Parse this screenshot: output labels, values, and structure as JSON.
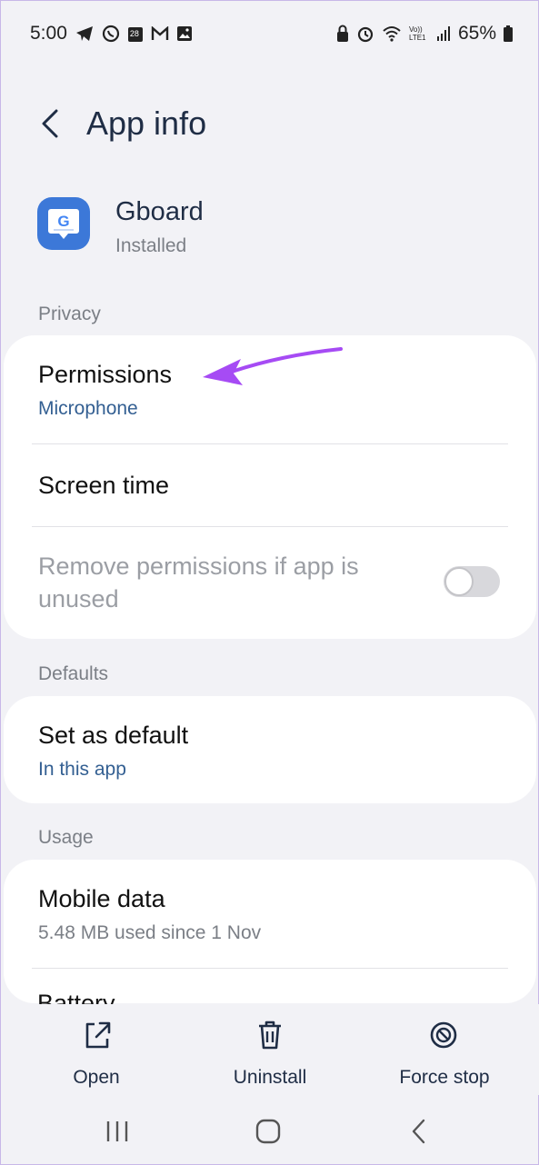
{
  "status_bar": {
    "time": "5:00",
    "battery": "65%",
    "left_icons": [
      "telegram-icon",
      "whatsapp-icon",
      "calendar-icon",
      "gmail-icon",
      "gallery-icon"
    ],
    "calendar_day": "28",
    "right_icons": [
      "lock-icon",
      "alarm-icon",
      "wifi-icon",
      "volte-icon",
      "signal-icon",
      "battery-icon"
    ],
    "volte_label": "Vo)) LTE1"
  },
  "header": {
    "title": "App info"
  },
  "app": {
    "name": "Gboard",
    "status": "Installed",
    "icon_letter": "G"
  },
  "privacy": {
    "section_label": "Privacy",
    "permissions_title": "Permissions",
    "permissions_sub": "Microphone",
    "screen_time": "Screen time",
    "remove_permissions": "Remove permissions if app is unused",
    "remove_toggle_on": false
  },
  "defaults": {
    "section_label": "Defaults",
    "set_default_title": "Set as default",
    "set_default_sub": "In this app"
  },
  "usage": {
    "section_label": "Usage",
    "mobile_data_title": "Mobile data",
    "mobile_data_sub": "5.48 MB used since 1 Nov",
    "battery_title": "Battery"
  },
  "actions": {
    "open": "Open",
    "uninstall": "Uninstall",
    "force_stop": "Force stop"
  },
  "colors": {
    "accent": "#335f92",
    "arrow": "#a64bf4",
    "background": "#f2f2f6"
  }
}
